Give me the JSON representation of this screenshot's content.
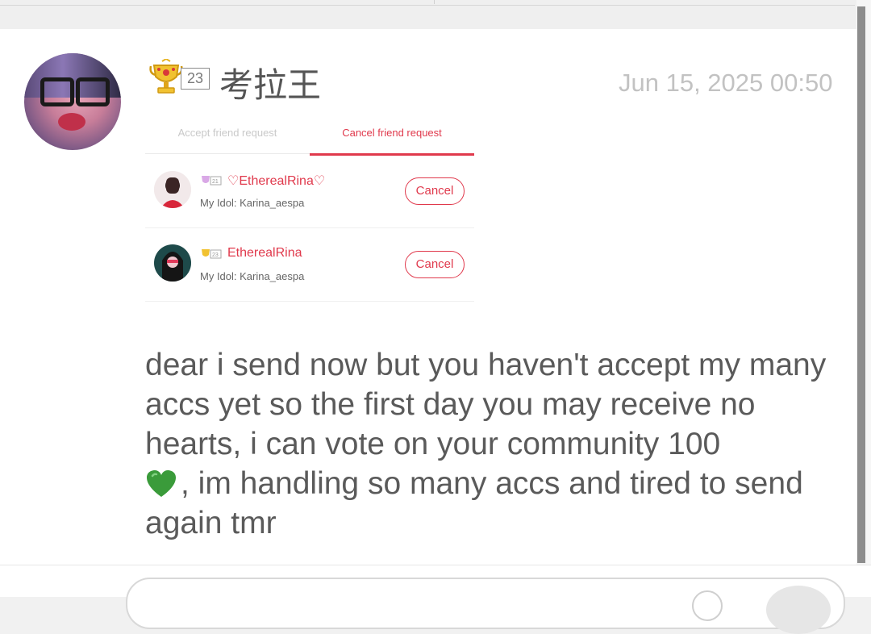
{
  "message": {
    "user": {
      "name": "考拉王",
      "level": "23"
    },
    "timestamp": "Jun 15, 2025 00:50",
    "body": "dear i send now but you haven't accept my many accs yet so the first day you may receive no hearts, i can vote on your community 100",
    "body_tail": ", im handling so many accs and tired to send again tmr",
    "emoji": "green-heart"
  },
  "embedded_screenshot": {
    "tabs": [
      {
        "label": "Accept friend request",
        "active": false
      },
      {
        "label": "Cancel friend request",
        "active": true
      }
    ],
    "requests": [
      {
        "name": "♡EtherealRina♡",
        "badge_level": "21",
        "idol": "My Idol: Karina_aespa",
        "action": "Cancel"
      },
      {
        "name": "EtherealRina",
        "badge_level": "23",
        "idol": "My Idol: Karina_aespa",
        "action": "Cancel"
      }
    ]
  },
  "colors": {
    "accent": "#e0394c",
    "text": "#5a5a5a",
    "timestamp": "#c2c2c2",
    "heart": "#3a9b3a"
  }
}
